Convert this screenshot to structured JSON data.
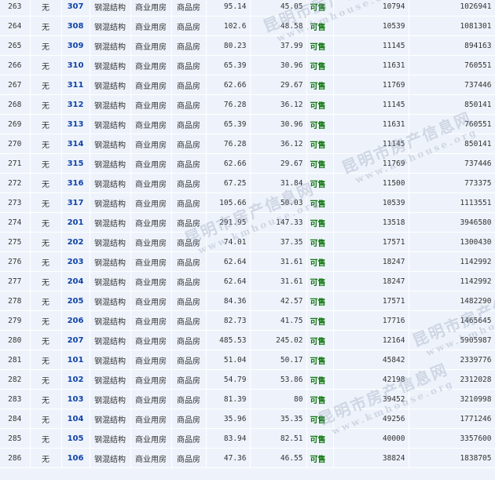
{
  "rows": [
    {
      "no": "263",
      "floor": "无",
      "room": "307",
      "structure": "钢混结构",
      "usage": "商业用房",
      "type": "商品房",
      "area_total": "95.14",
      "area_inner": "45.05",
      "status": "可售",
      "unit_price": "10794",
      "total_price": "1026941"
    },
    {
      "no": "264",
      "floor": "无",
      "room": "308",
      "structure": "钢混结构",
      "usage": "商业用房",
      "type": "商品房",
      "area_total": "102.6",
      "area_inner": "48.58",
      "status": "可售",
      "unit_price": "10539",
      "total_price": "1081301"
    },
    {
      "no": "265",
      "floor": "无",
      "room": "309",
      "structure": "钢混结构",
      "usage": "商业用房",
      "type": "商品房",
      "area_total": "80.23",
      "area_inner": "37.99",
      "status": "可售",
      "unit_price": "11145",
      "total_price": "894163"
    },
    {
      "no": "266",
      "floor": "无",
      "room": "310",
      "structure": "钢混结构",
      "usage": "商业用房",
      "type": "商品房",
      "area_total": "65.39",
      "area_inner": "30.96",
      "status": "可售",
      "unit_price": "11631",
      "total_price": "760551"
    },
    {
      "no": "267",
      "floor": "无",
      "room": "311",
      "structure": "钢混结构",
      "usage": "商业用房",
      "type": "商品房",
      "area_total": "62.66",
      "area_inner": "29.67",
      "status": "可售",
      "unit_price": "11769",
      "total_price": "737446"
    },
    {
      "no": "268",
      "floor": "无",
      "room": "312",
      "structure": "钢混结构",
      "usage": "商业用房",
      "type": "商品房",
      "area_total": "76.28",
      "area_inner": "36.12",
      "status": "可售",
      "unit_price": "11145",
      "total_price": "850141"
    },
    {
      "no": "269",
      "floor": "无",
      "room": "313",
      "structure": "钢混结构",
      "usage": "商业用房",
      "type": "商品房",
      "area_total": "65.39",
      "area_inner": "30.96",
      "status": "可售",
      "unit_price": "11631",
      "total_price": "760551"
    },
    {
      "no": "270",
      "floor": "无",
      "room": "314",
      "structure": "钢混结构",
      "usage": "商业用房",
      "type": "商品房",
      "area_total": "76.28",
      "area_inner": "36.12",
      "status": "可售",
      "unit_price": "11145",
      "total_price": "850141"
    },
    {
      "no": "271",
      "floor": "无",
      "room": "315",
      "structure": "钢混结构",
      "usage": "商业用房",
      "type": "商品房",
      "area_total": "62.66",
      "area_inner": "29.67",
      "status": "可售",
      "unit_price": "11769",
      "total_price": "737446"
    },
    {
      "no": "272",
      "floor": "无",
      "room": "316",
      "structure": "钢混结构",
      "usage": "商业用房",
      "type": "商品房",
      "area_total": "67.25",
      "area_inner": "31.84",
      "status": "可售",
      "unit_price": "11500",
      "total_price": "773375"
    },
    {
      "no": "273",
      "floor": "无",
      "room": "317",
      "structure": "钢混结构",
      "usage": "商业用房",
      "type": "商品房",
      "area_total": "105.66",
      "area_inner": "50.03",
      "status": "可售",
      "unit_price": "10539",
      "total_price": "1113551"
    },
    {
      "no": "274",
      "floor": "无",
      "room": "201",
      "structure": "钢混结构",
      "usage": "商业用房",
      "type": "商品房",
      "area_total": "291.95",
      "area_inner": "147.33",
      "status": "可售",
      "unit_price": "13518",
      "total_price": "3946580"
    },
    {
      "no": "275",
      "floor": "无",
      "room": "202",
      "structure": "钢混结构",
      "usage": "商业用房",
      "type": "商品房",
      "area_total": "74.01",
      "area_inner": "37.35",
      "status": "可售",
      "unit_price": "17571",
      "total_price": "1300430"
    },
    {
      "no": "276",
      "floor": "无",
      "room": "203",
      "structure": "钢混结构",
      "usage": "商业用房",
      "type": "商品房",
      "area_total": "62.64",
      "area_inner": "31.61",
      "status": "可售",
      "unit_price": "18247",
      "total_price": "1142992"
    },
    {
      "no": "277",
      "floor": "无",
      "room": "204",
      "structure": "钢混结构",
      "usage": "商业用房",
      "type": "商品房",
      "area_total": "62.64",
      "area_inner": "31.61",
      "status": "可售",
      "unit_price": "18247",
      "total_price": "1142992"
    },
    {
      "no": "278",
      "floor": "无",
      "room": "205",
      "structure": "钢混结构",
      "usage": "商业用房",
      "type": "商品房",
      "area_total": "84.36",
      "area_inner": "42.57",
      "status": "可售",
      "unit_price": "17571",
      "total_price": "1482290"
    },
    {
      "no": "279",
      "floor": "无",
      "room": "206",
      "structure": "钢混结构",
      "usage": "商业用房",
      "type": "商品房",
      "area_total": "82.73",
      "area_inner": "41.75",
      "status": "可售",
      "unit_price": "17716",
      "total_price": "1465645"
    },
    {
      "no": "280",
      "floor": "无",
      "room": "207",
      "structure": "钢混结构",
      "usage": "商业用房",
      "type": "商品房",
      "area_total": "485.53",
      "area_inner": "245.02",
      "status": "可售",
      "unit_price": "12164",
      "total_price": "5905987"
    },
    {
      "no": "281",
      "floor": "无",
      "room": "101",
      "structure": "钢混结构",
      "usage": "商业用房",
      "type": "商品房",
      "area_total": "51.04",
      "area_inner": "50.17",
      "status": "可售",
      "unit_price": "45842",
      "total_price": "2339776"
    },
    {
      "no": "282",
      "floor": "无",
      "room": "102",
      "structure": "钢混结构",
      "usage": "商业用房",
      "type": "商品房",
      "area_total": "54.79",
      "area_inner": "53.86",
      "status": "可售",
      "unit_price": "42198",
      "total_price": "2312028"
    },
    {
      "no": "283",
      "floor": "无",
      "room": "103",
      "structure": "钢混结构",
      "usage": "商业用房",
      "type": "商品房",
      "area_total": "81.39",
      "area_inner": "80",
      "status": "可售",
      "unit_price": "39452",
      "total_price": "3210998"
    },
    {
      "no": "284",
      "floor": "无",
      "room": "104",
      "structure": "钢混结构",
      "usage": "商业用房",
      "type": "商品房",
      "area_total": "35.96",
      "area_inner": "35.35",
      "status": "可售",
      "unit_price": "49256",
      "total_price": "1771246"
    },
    {
      "no": "285",
      "floor": "无",
      "room": "105",
      "structure": "钢混结构",
      "usage": "商业用房",
      "type": "商品房",
      "area_total": "83.94",
      "area_inner": "82.51",
      "status": "可售",
      "unit_price": "40000",
      "total_price": "3357600"
    },
    {
      "no": "286",
      "floor": "无",
      "room": "106",
      "structure": "钢混结构",
      "usage": "商业用房",
      "type": "商品房",
      "area_total": "47.36",
      "area_inner": "46.55",
      "status": "可售",
      "unit_price": "38824",
      "total_price": "1838705"
    }
  ],
  "watermark": {
    "cn": "昆明市房产信息网",
    "en": "www.kmhouse.org"
  }
}
